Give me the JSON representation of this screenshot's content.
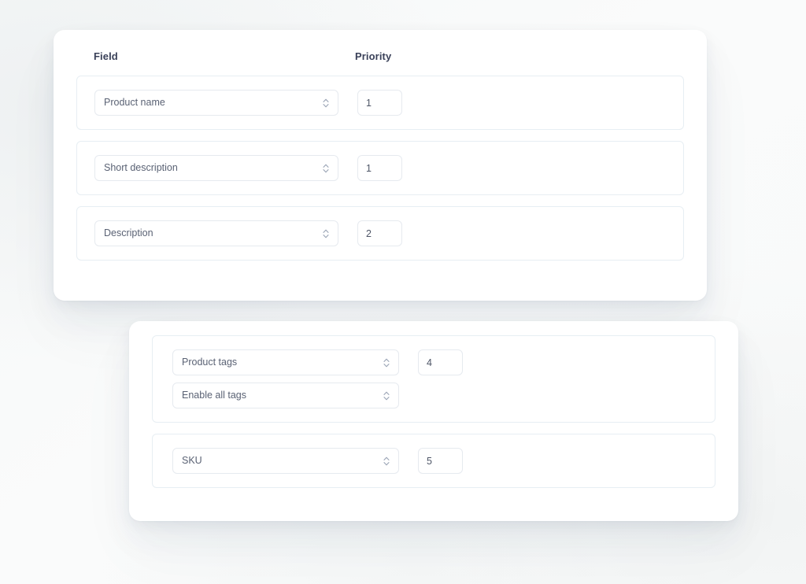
{
  "background": {
    "base_color": "#fbfcfc",
    "tint_color": "#eef1f2"
  },
  "theme": {
    "card_background": "#ffffff",
    "row_border": "#e7eef3",
    "control_border": "#e6eaef",
    "header_text": "#3a4159",
    "value_text": "#5a6274",
    "input_text": "#4d5566"
  },
  "cards": [
    {
      "id": "fields-card",
      "show_headers": true,
      "headers": {
        "field": "Field",
        "priority": "Priority"
      },
      "rows": [
        {
          "id": "row-product-name",
          "selects": [
            {
              "name": "field-select",
              "value": "Product name",
              "icon": "chevron-updown-icon"
            }
          ],
          "priority": {
            "name": "priority-input",
            "value": "1",
            "placeholder": "0"
          }
        },
        {
          "id": "row-short-description",
          "selects": [
            {
              "name": "field-select",
              "value": "Short description",
              "icon": "chevron-updown-icon"
            }
          ],
          "priority": {
            "name": "priority-input",
            "value": "1",
            "placeholder": "0"
          }
        },
        {
          "id": "row-description",
          "selects": [
            {
              "name": "field-select",
              "value": "Description",
              "icon": "chevron-updown-icon"
            }
          ],
          "priority": {
            "name": "priority-input",
            "value": "2",
            "placeholder": "0"
          }
        }
      ]
    },
    {
      "id": "extra-card",
      "show_headers": false,
      "headers": {
        "field": "",
        "priority": ""
      },
      "rows": [
        {
          "id": "row-product-tags",
          "selects": [
            {
              "name": "field-select",
              "value": "Product tags",
              "icon": "chevron-updown-icon"
            },
            {
              "name": "tag-option-select",
              "value": "Enable all tags",
              "icon": "chevron-updown-icon"
            }
          ],
          "priority": {
            "name": "priority-input",
            "value": "4",
            "placeholder": "0"
          }
        },
        {
          "id": "row-sku",
          "selects": [
            {
              "name": "field-select",
              "value": "SKU",
              "icon": "chevron-updown-icon"
            }
          ],
          "priority": {
            "name": "priority-input",
            "value": "5",
            "placeholder": "0"
          }
        }
      ]
    }
  ]
}
